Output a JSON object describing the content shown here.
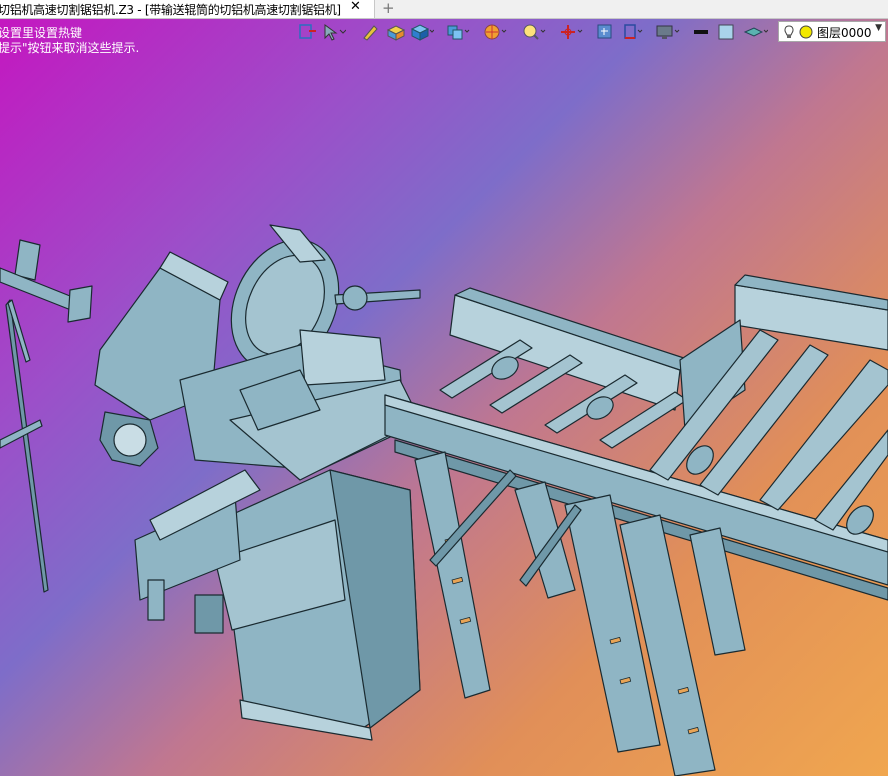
{
  "tab": {
    "title": "切铝机高速切割锯铝机.Z3 - [带输送辊筒的切铝机高速切割锯铝机]",
    "close_icon": "close-icon",
    "add_icon": "plus-icon"
  },
  "hints": {
    "line1": "设置里设置热键",
    "line2": "提示\"按钮来取消这些提示."
  },
  "toolbar": {
    "icons": [
      "exit-sketch-icon",
      "pointer-icon",
      "pencil-icon",
      "box-icon",
      "cube-icon",
      "cube-group-icon",
      "render-sphere-icon",
      "view-magnify-icon",
      "axis-icon",
      "fit-view-icon",
      "plane-icon",
      "monitor-icon",
      "line-style-icon",
      "fill-color-icon",
      "layer-stack-icon"
    ]
  },
  "layer": {
    "name": "图层0000",
    "bulb_icon": "lightbulb-icon",
    "color": "#f2e800"
  },
  "colors": {
    "model": "#8fb5c4",
    "model_dark": "#6f98a8",
    "model_light": "#b7d2dc"
  }
}
